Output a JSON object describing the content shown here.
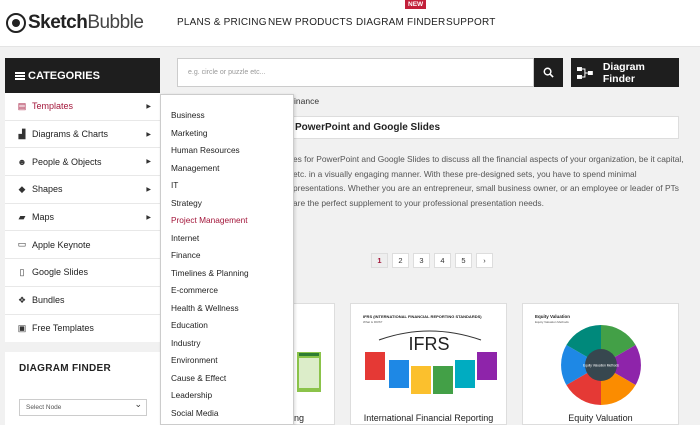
{
  "brand": {
    "name_bold": "Sketch",
    "name_light": "Bubble",
    "accent": "#a3163a"
  },
  "topnav": {
    "items": [
      "PLANS & PRICING",
      "NEW PRODUCTS",
      "DIAGRAM FINDER",
      "SUPPORT"
    ],
    "badge": "NEW"
  },
  "sidebar": {
    "header": "CATEGORIES",
    "items": [
      {
        "label": "Templates",
        "icon": "template-icon",
        "has_submenu": true,
        "active": true
      },
      {
        "label": "Diagrams & Charts",
        "icon": "chart-icon",
        "has_submenu": true
      },
      {
        "label": "People & Objects",
        "icon": "people-icon",
        "has_submenu": true
      },
      {
        "label": "Shapes",
        "icon": "cube-icon",
        "has_submenu": true
      },
      {
        "label": "Maps",
        "icon": "map-icon",
        "has_submenu": true
      },
      {
        "label": "Apple Keynote",
        "icon": "monitor-icon",
        "has_submenu": false
      },
      {
        "label": "Google Slides",
        "icon": "document-icon",
        "has_submenu": false
      },
      {
        "label": "Bundles",
        "icon": "bundle-icon",
        "has_submenu": false
      },
      {
        "label": "Free Templates",
        "icon": "gift-icon",
        "has_submenu": false
      }
    ]
  },
  "diagram_finder": {
    "title": "DIAGRAM FINDER",
    "select_value": "Select Node"
  },
  "search": {
    "placeholder": "e.g. circle or puzzle etc...",
    "button_label": "Diagram Finder"
  },
  "main": {
    "breadcrumb": "inance",
    "title": "PowerPoint and Google Slides",
    "description": "es for PowerPoint and Google Slides to discuss all the financial aspects of your organization, be it capital, etc. in a visually engaging manner. With these pre-designed sets, you have to spend minimal presentations. Whether you are an entrepreneur, small business owner, or an employee or leader of PTs are the perfect supplement to your professional presentation needs.",
    "pagination": [
      "1",
      "2",
      "3",
      "4",
      "5",
      "›"
    ],
    "current_page": "1",
    "cards": [
      {
        "title": "ing",
        "image_heading": ""
      },
      {
        "title": "International Financial Reporting",
        "image_heading": "IFRS (INTERNATIONAL FINANCIAL REPORTING STANDARDS)",
        "image_sub": "What is IFRS?",
        "image_word": "IFRS"
      },
      {
        "title": "Equity Valuation",
        "image_heading": "Equity Valuation",
        "image_sub": "Equity Valuation Methods",
        "image_center": "Equity Valuation Methods"
      }
    ]
  },
  "dropdown": {
    "items": [
      "Business",
      "Marketing",
      "Human Resources",
      "Management",
      "IT",
      "Strategy",
      "Project Management",
      "Internet",
      "Finance",
      "Timelines & Planning",
      "E-commerce",
      "Health & Wellness",
      "Education",
      "Industry",
      "Environment",
      "Cause & Effect",
      "Leadership",
      "Social Media"
    ],
    "highlighted": "Project Management"
  }
}
